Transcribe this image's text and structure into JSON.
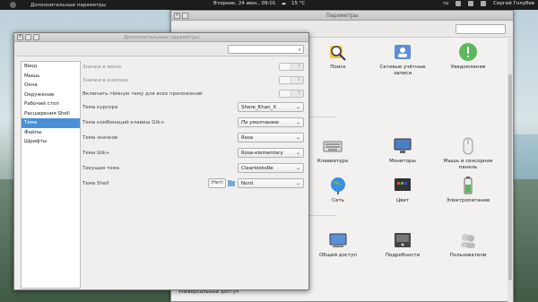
{
  "top_panel": {
    "app_name": "Дополнительные параметры",
    "datetime": "Вторник, 24 июн., 09:01",
    "weather": "15 °C",
    "keyboard": "ru",
    "user": "Сергей Голубев"
  },
  "settings_window": {
    "title": "Параметры",
    "footer_label": "Универсальный доступ",
    "items": [
      {
        "label": "Поиск",
        "icon": "search-icon"
      },
      {
        "label": "Сетевые учётные записи",
        "icon": "online-accounts-icon"
      },
      {
        "label": "Уведомления",
        "icon": "notifications-icon"
      },
      {
        "label": "Клавиатура",
        "icon": "keyboard-icon"
      },
      {
        "label": "Мониторы",
        "icon": "displays-icon"
      },
      {
        "label": "Мышь и сенсорная панель",
        "icon": "mouse-icon"
      },
      {
        "label": "Сеть",
        "icon": "network-icon"
      },
      {
        "label": "Цвет",
        "icon": "color-icon"
      },
      {
        "label": "Электропитание",
        "icon": "power-icon"
      },
      {
        "label": "Общий доступ",
        "icon": "sharing-icon"
      },
      {
        "label": "Подробности",
        "icon": "details-icon"
      },
      {
        "label": "Пользователи",
        "icon": "users-icon"
      }
    ]
  },
  "tweak_window": {
    "title": "Дополнительные параметры",
    "sidebar": [
      {
        "label": "Ввод"
      },
      {
        "label": "Мышь"
      },
      {
        "label": "Окна"
      },
      {
        "label": "Окружение"
      },
      {
        "label": "Рабочий стол"
      },
      {
        "label": "Расширения Shell"
      },
      {
        "label": "Тема",
        "selected": true
      },
      {
        "label": "Файлы"
      },
      {
        "label": "Шрифты"
      }
    ],
    "rows": {
      "menu_icons": {
        "label": "Значки в меню",
        "state": "0"
      },
      "button_icons": {
        "label": "Значки в кнопках",
        "state": "0"
      },
      "dark_theme": {
        "label": "Включить тёмную тему для всех приложений",
        "state": "0"
      },
      "cursor_theme": {
        "label": "Тема курсора",
        "value": "Shere_Khan_X"
      },
      "keybinding_theme": {
        "label": "Тема комбинаций клавиш Gtk+",
        "value": "По умолчанию"
      },
      "icon_theme": {
        "label": "Тема значков",
        "value": "Rosa"
      },
      "gtk_theme": {
        "label": "Тема Gtk+",
        "value": "Rosa-elementary"
      },
      "current_theme": {
        "label": "Текущая тема",
        "value": "ClearlooksRe"
      },
      "shell_theme": {
        "label": "Тема Shell",
        "none_label": "(Нет)",
        "value": "Nord"
      }
    }
  },
  "colors": {
    "selection": "#4a90d9",
    "panel": "#1d1d1d"
  }
}
